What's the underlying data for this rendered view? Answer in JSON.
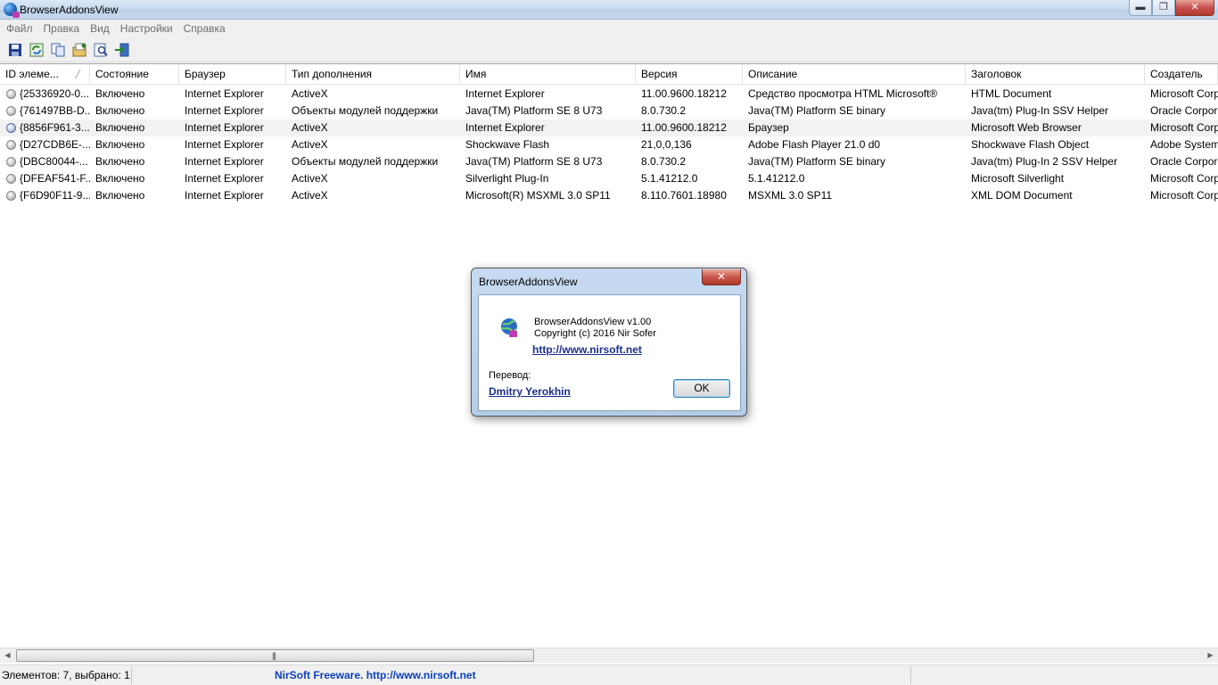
{
  "window": {
    "title": "BrowserAddonsView",
    "controls": {
      "minimize": "▬",
      "maximize": "❐",
      "close": "✕"
    }
  },
  "menu": [
    "Файл",
    "Правка",
    "Вид",
    "Настройки",
    "Справка"
  ],
  "toolbar": {
    "buttons": [
      "save-icon",
      "refresh-icon",
      "copy-icon",
      "properties-icon",
      "find-icon",
      "exit-icon"
    ]
  },
  "table": {
    "columns": [
      "ID элеме...",
      "Состояние",
      "Браузер",
      "Тип дополнения",
      "Имя",
      "Версия",
      "Описание",
      "Заголовок",
      "Создатель"
    ],
    "selected_row": 2,
    "rows": [
      [
        "{25336920-0...",
        "Включено",
        "Internet Explorer",
        "ActiveX",
        "Internet Explorer",
        "11.00.9600.18212",
        "Средство просмотра HTML Microsoft®",
        "HTML Document",
        "Microsoft Corp"
      ],
      [
        "{761497BB-D...",
        "Включено",
        "Internet Explorer",
        "Объекты модулей поддержки",
        "Java(TM) Platform SE 8 U73",
        "8.0.730.2",
        "Java(TM) Platform SE binary",
        "Java(tm) Plug-In SSV Helper",
        "Oracle Corpor"
      ],
      [
        "{8856F961-3...",
        "Включено",
        "Internet Explorer",
        "ActiveX",
        "Internet Explorer",
        "11.00.9600.18212",
        "Браузер",
        "Microsoft Web Browser",
        "Microsoft Corp"
      ],
      [
        "{D27CDB6E-...",
        "Включено",
        "Internet Explorer",
        "ActiveX",
        "Shockwave Flash",
        "21,0,0,136",
        "Adobe Flash Player 21.0 d0",
        "Shockwave Flash Object",
        "Adobe System"
      ],
      [
        "{DBC80044-...",
        "Включено",
        "Internet Explorer",
        "Объекты модулей поддержки",
        "Java(TM) Platform SE 8 U73",
        "8.0.730.2",
        "Java(TM) Platform SE binary",
        "Java(tm) Plug-In 2 SSV Helper",
        "Oracle Corpor"
      ],
      [
        "{DFEAF541-F...",
        "Включено",
        "Internet Explorer",
        "ActiveX",
        "Silverlight Plug-In",
        "5.1.41212.0",
        "5.1.41212.0",
        "Microsoft Silverlight",
        "Microsoft Corp"
      ],
      [
        "{F6D90F11-9...",
        "Включено",
        "Internet Explorer",
        "ActiveX",
        "Microsoft(R) MSXML 3.0 SP11",
        "8.110.7601.18980",
        "MSXML 3.0 SP11",
        "XML DOM Document",
        "Microsoft Corp"
      ]
    ]
  },
  "scrollbar": {
    "left_arrow": "◀",
    "right_arrow": "▶",
    "grip": "|||"
  },
  "status": {
    "count": "Элементов: 7, выбрано: 1",
    "link": "NirSoft Freeware.  http://www.nirsoft.net"
  },
  "dialog": {
    "title": "BrowserAddonsView",
    "close": "✕",
    "line1": "BrowserAddonsView v1.00",
    "line2": "Copyright (c) 2016 Nir Sofer",
    "link": "http://www.nirsoft.net",
    "translation_label": "Перевод:",
    "translator": "Dmitry Yerokhin",
    "ok": "OK"
  }
}
